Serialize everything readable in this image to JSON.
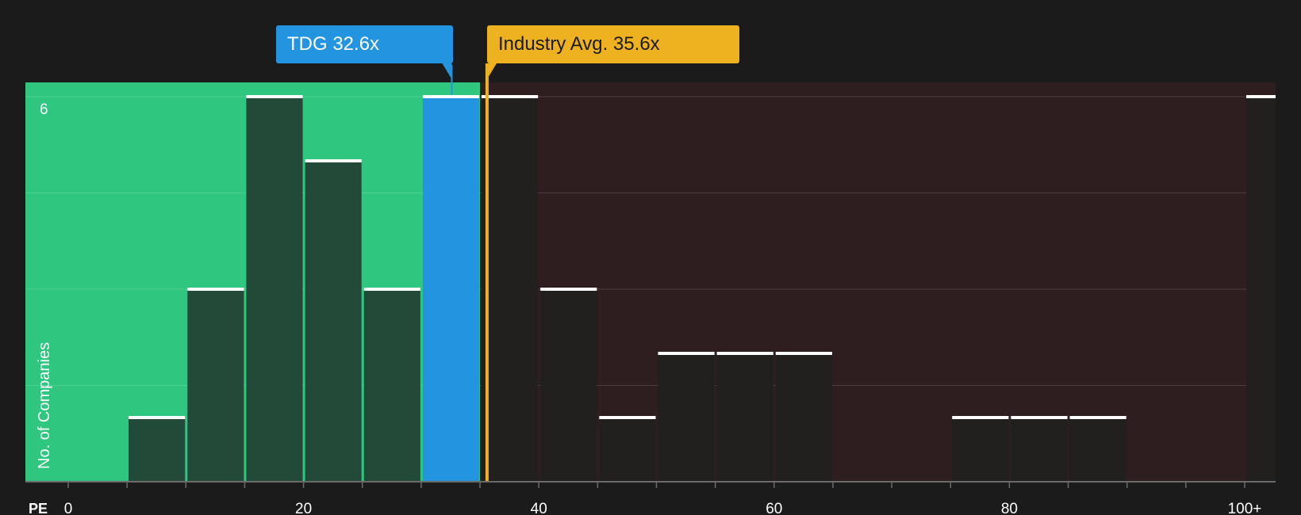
{
  "chart_data": {
    "type": "bar",
    "xlabel": "PE",
    "ylabel": "No. of Companies",
    "x_bin_width": 5,
    "x_ticks": [
      {
        "value": 0,
        "label": "0"
      },
      {
        "value": 20,
        "label": "20"
      },
      {
        "value": 40,
        "label": "40"
      },
      {
        "value": 60,
        "label": "60"
      },
      {
        "value": 80,
        "label": "80"
      },
      {
        "value": 100,
        "label": "100+"
      }
    ],
    "y_ticks": [
      {
        "value": 6,
        "label": "6"
      }
    ],
    "ylim": [
      0,
      6
    ],
    "grid": true,
    "bins": [
      {
        "x": 5,
        "count": 1
      },
      {
        "x": 10,
        "count": 3
      },
      {
        "x": 15,
        "count": 6
      },
      {
        "x": 20,
        "count": 5
      },
      {
        "x": 25,
        "count": 3
      },
      {
        "x": 30,
        "count": 6,
        "highlight": true
      },
      {
        "x": 35,
        "count": 6
      },
      {
        "x": 40,
        "count": 3
      },
      {
        "x": 45,
        "count": 1
      },
      {
        "x": 50,
        "count": 2
      },
      {
        "x": 55,
        "count": 2
      },
      {
        "x": 60,
        "count": 2
      },
      {
        "x": 75,
        "count": 1
      },
      {
        "x": 80,
        "count": 1
      },
      {
        "x": 85,
        "count": 1
      },
      {
        "x": 100,
        "count": 6
      }
    ],
    "company": {
      "name": "TDG",
      "value": 32.6,
      "label": "TDG 32.6x"
    },
    "industry": {
      "name": "Industry Avg.",
      "value": 35.6,
      "label": "Industry Avg. 35.6x"
    },
    "colors": {
      "background": "#1b1b1b",
      "undervalued_zone": "#2fc77f",
      "overvalued_zone": "#2e1e20",
      "bar_in_green": "#234a38",
      "bar_in_red": "#221f1f",
      "highlight_bar": "#2394e0",
      "bar_cap": "#ffffff",
      "industry_line": "#eeb11f",
      "axis_text": "#ffffff"
    }
  }
}
